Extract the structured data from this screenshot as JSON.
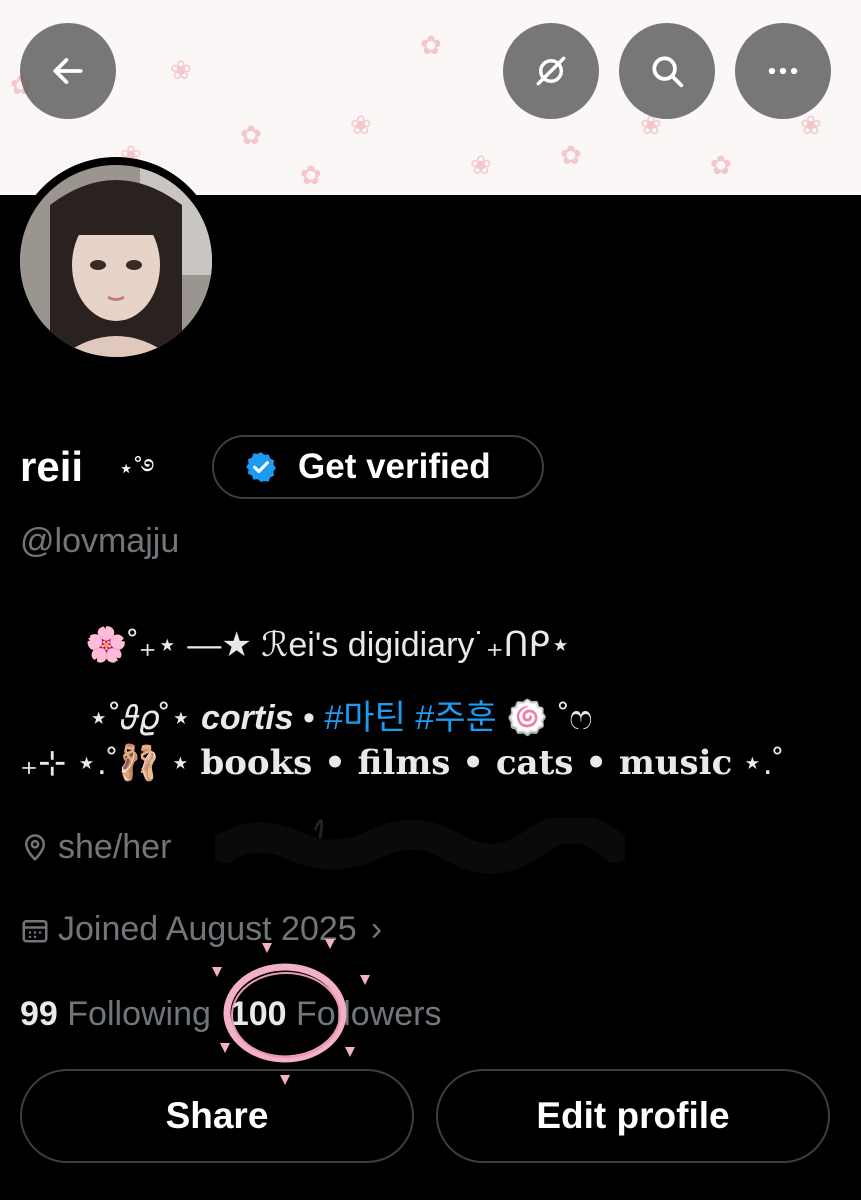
{
  "profile": {
    "name": "reii",
    "name_decoration": "⋆˚࿔",
    "handle": "@lovmajju",
    "verify_button": "Get verified"
  },
  "bio": {
    "line1": "🌸˚₊⋆ —★ ℛei's digidiary˙₊ᑎᑭ⋆",
    "line2_pre": "⋆˚𝜗𝜚˚⋆",
    "line2_bold": "cortis",
    "line2_sep": "•",
    "line2_tags": "#마틴 #주훈",
    "line2_post": "🍥 ˚ෆ",
    "line3_pre": "₊⊹ ⋆.˚🩰 ⋆",
    "line3_text": "books • films • cats • music",
    "line3_post": "⋆.˚"
  },
  "meta": {
    "location": "she/her",
    "joined": "Joined August 2025",
    "joined_chevron": "›"
  },
  "stats": {
    "following_count": "99",
    "following_label": "Following",
    "followers_count": "100",
    "followers_label": "Followers"
  },
  "buttons": {
    "share": "Share",
    "edit_profile": "Edit profile"
  },
  "colors": {
    "accent": "#1d9bf0",
    "muted": "#71767b",
    "doodle": "#f4b0c4"
  },
  "icons": [
    "back-arrow-icon",
    "grok-icon",
    "search-icon",
    "more-icon",
    "verified-badge-icon",
    "location-icon",
    "calendar-icon"
  ]
}
